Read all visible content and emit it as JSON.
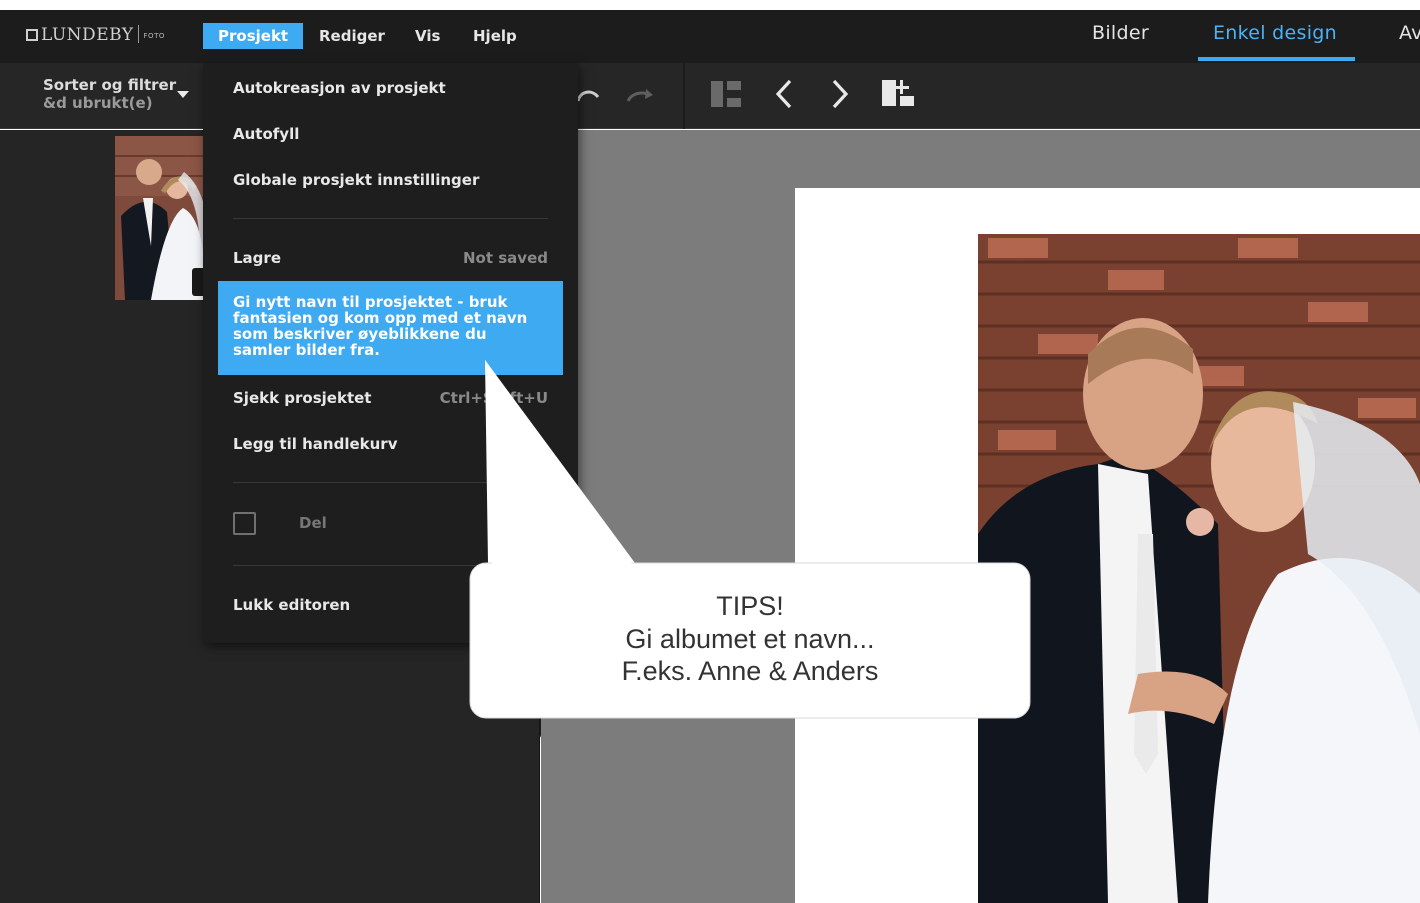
{
  "app": {
    "logo": {
      "brand": "LUNDEBY",
      "sub": "FOTO"
    },
    "menu": [
      {
        "label": "Prosjekt",
        "active": true
      },
      {
        "label": "Rediger",
        "active": false
      },
      {
        "label": "Vis",
        "active": false
      },
      {
        "label": "Hjelp",
        "active": false
      }
    ],
    "nav_tabs": [
      {
        "label": "Bilder",
        "active": false
      },
      {
        "label": "Enkel design",
        "active": true
      },
      {
        "label": "Av",
        "active": false
      }
    ]
  },
  "toolbar": {
    "sort_filter_label": "Sorter og filtrer",
    "sort_filter_sub": "&d ubrukt(e)",
    "icons": [
      "undo-icon",
      "redo-icon",
      "layout-icon",
      "previous-page-icon",
      "next-page-icon",
      "add-page-icon"
    ]
  },
  "dropdown": {
    "items": [
      {
        "label": "Autokreasjon av prosjekt"
      },
      {
        "label": "Autofyll"
      },
      {
        "label": "Globale prosjekt innstillinger"
      },
      {
        "label": "Lagre",
        "status": "Not saved"
      },
      {
        "label": "Gi nytt navn til prosjektet - bruk fantasien og kom opp med et navn som beskriver øyeblikkene du samler bilder fra.",
        "highlighted": true
      },
      {
        "label": "Sjekk prosjektet",
        "shortcut": "Ctrl+Shift+U"
      },
      {
        "label": "Legg til handlekurv"
      },
      {
        "label": "Del",
        "checkbox": true,
        "checked": false,
        "disabled": true
      },
      {
        "label": "Lukk editoren"
      }
    ]
  },
  "callout": {
    "line1": "TIPS!",
    "line2": "Gi albumet et navn...",
    "line3": "F.eks. Anne & Anders"
  },
  "colors": {
    "accent": "#3daaf2",
    "topbar": "#1c1c1c",
    "toolbar": "#262626",
    "panel": "#252525",
    "canvas": "#7c7c7c",
    "menu_bg": "#1e1e1e"
  }
}
